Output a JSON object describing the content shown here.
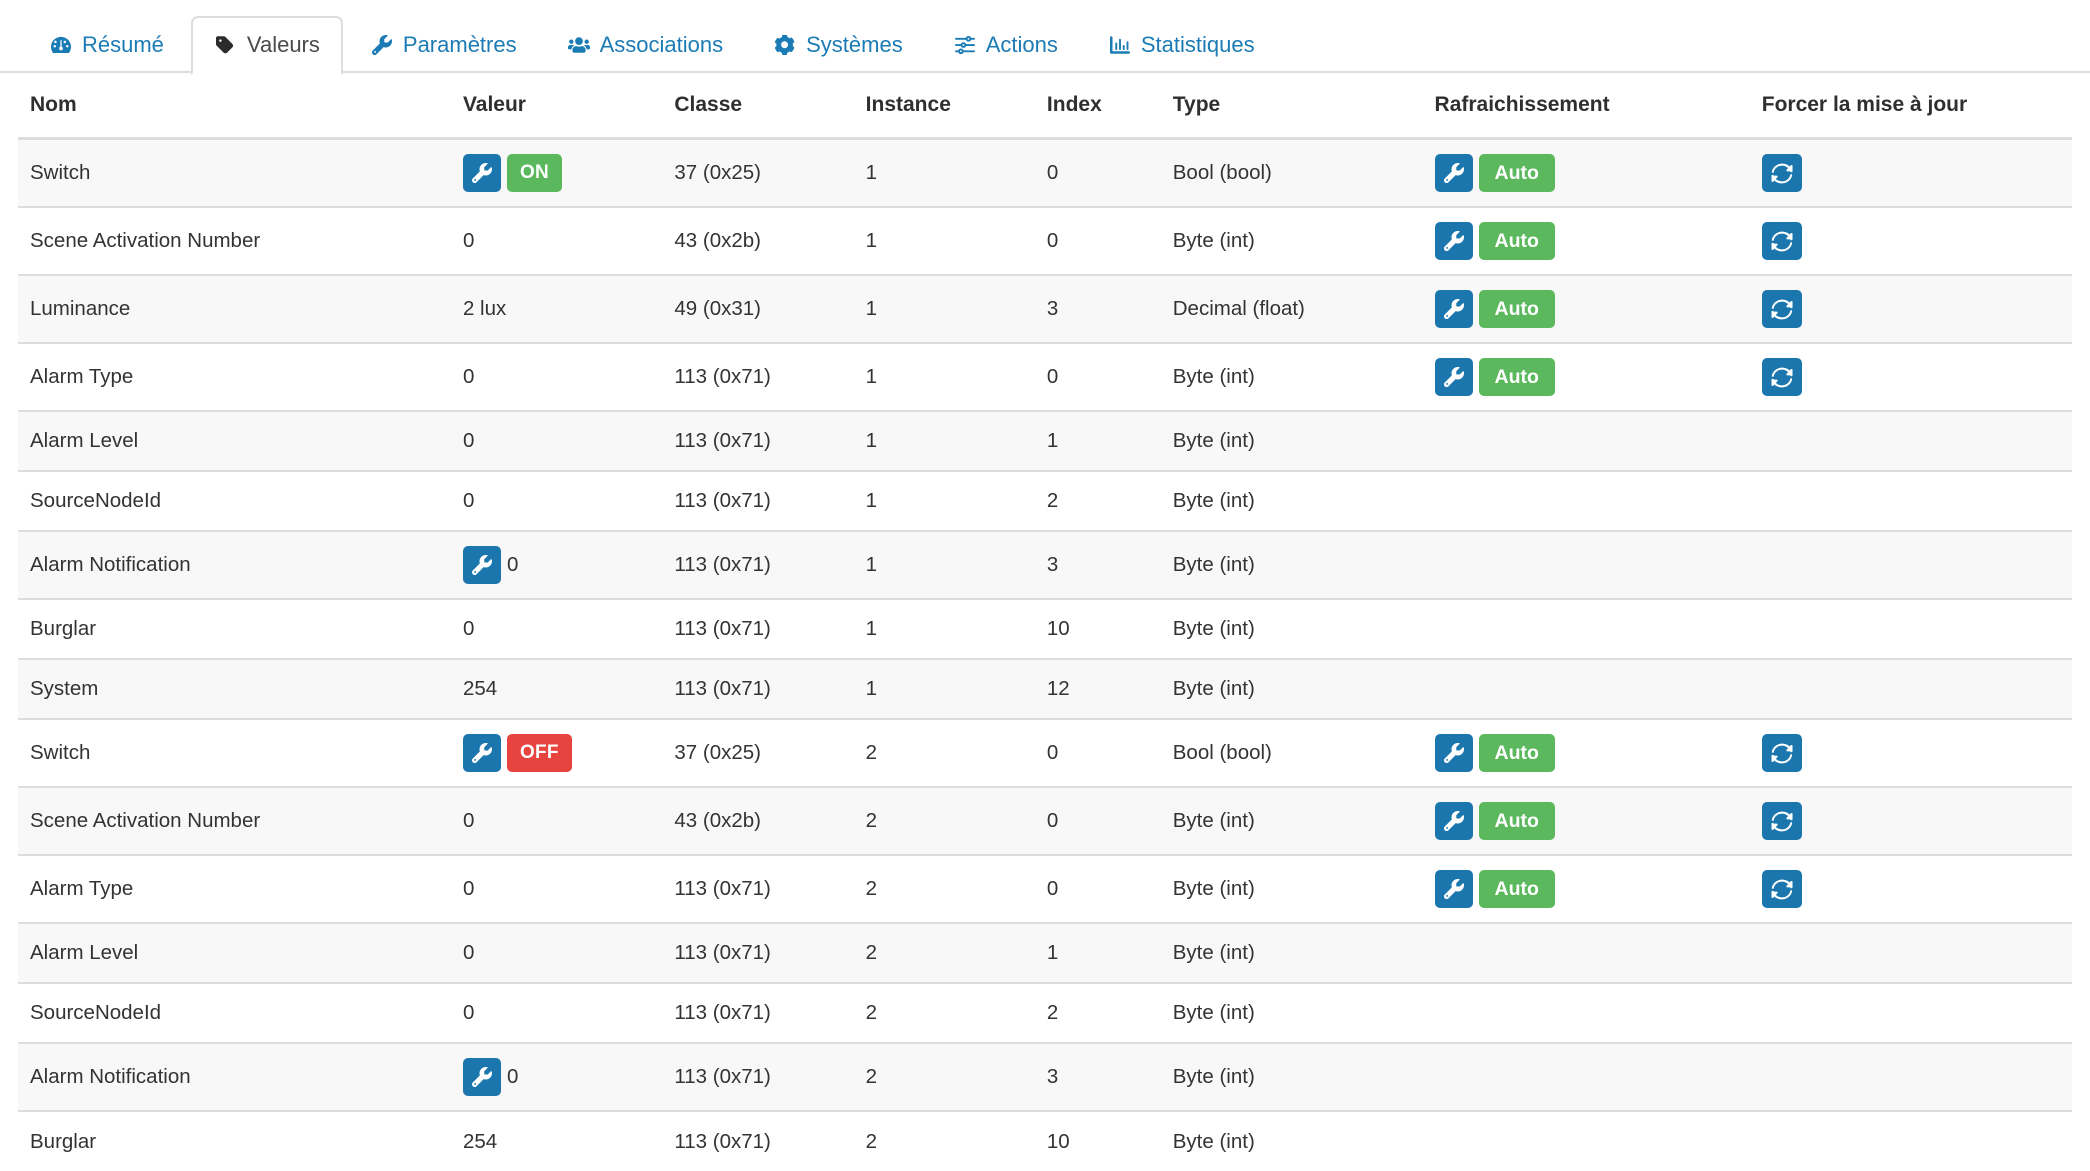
{
  "tabs": [
    {
      "label": "Résumé",
      "icon": "dashboard-icon",
      "active": false
    },
    {
      "label": "Valeurs",
      "icon": "tag-icon",
      "active": true
    },
    {
      "label": "Paramètres",
      "icon": "wrench-icon",
      "active": false
    },
    {
      "label": "Associations",
      "icon": "users-icon",
      "active": false
    },
    {
      "label": "Systèmes",
      "icon": "cogs-icon",
      "active": false
    },
    {
      "label": "Actions",
      "icon": "sliders-icon",
      "active": false
    },
    {
      "label": "Statistiques",
      "icon": "bar-chart-icon",
      "active": false
    }
  ],
  "table": {
    "columns": [
      "Nom",
      "Valeur",
      "Classe",
      "Instance",
      "Index",
      "Type",
      "Rafraichissement",
      "Forcer la mise à jour"
    ],
    "rows": [
      {
        "nom": "Switch",
        "valeur": "ON",
        "valeur_kind": "state-on",
        "classe": "37 (0x25)",
        "instance": "1",
        "index": "0",
        "type": "Bool (bool)",
        "rafraichissement": "Auto",
        "has_refresh_group": true,
        "has_force_button": true
      },
      {
        "nom": "Scene Activation Number",
        "valeur": "0",
        "valeur_kind": "plain",
        "classe": "43 (0x2b)",
        "instance": "1",
        "index": "0",
        "type": "Byte (int)",
        "rafraichissement": "Auto",
        "has_refresh_group": true,
        "has_force_button": true
      },
      {
        "nom": "Luminance",
        "valeur": "2 lux",
        "valeur_kind": "plain",
        "classe": "49 (0x31)",
        "instance": "1",
        "index": "3",
        "type": "Decimal (float)",
        "rafraichissement": "Auto",
        "has_refresh_group": true,
        "has_force_button": true
      },
      {
        "nom": "Alarm Type",
        "valeur": "0",
        "valeur_kind": "plain",
        "classe": "113 (0x71)",
        "instance": "1",
        "index": "0",
        "type": "Byte (int)",
        "rafraichissement": "Auto",
        "has_refresh_group": true,
        "has_force_button": true
      },
      {
        "nom": "Alarm Level",
        "valeur": "0",
        "valeur_kind": "plain",
        "classe": "113 (0x71)",
        "instance": "1",
        "index": "1",
        "type": "Byte (int)",
        "rafraichissement": "",
        "has_refresh_group": false,
        "has_force_button": false
      },
      {
        "nom": "SourceNodeId",
        "valeur": "0",
        "valeur_kind": "plain",
        "classe": "113 (0x71)",
        "instance": "1",
        "index": "2",
        "type": "Byte (int)",
        "rafraichissement": "",
        "has_refresh_group": false,
        "has_force_button": false
      },
      {
        "nom": "Alarm Notification",
        "valeur": "0",
        "valeur_kind": "wrench-plain",
        "classe": "113 (0x71)",
        "instance": "1",
        "index": "3",
        "type": "Byte (int)",
        "rafraichissement": "",
        "has_refresh_group": false,
        "has_force_button": false
      },
      {
        "nom": "Burglar",
        "valeur": "0",
        "valeur_kind": "plain",
        "classe": "113 (0x71)",
        "instance": "1",
        "index": "10",
        "type": "Byte (int)",
        "rafraichissement": "",
        "has_refresh_group": false,
        "has_force_button": false
      },
      {
        "nom": "System",
        "valeur": "254",
        "valeur_kind": "plain",
        "classe": "113 (0x71)",
        "instance": "1",
        "index": "12",
        "type": "Byte (int)",
        "rafraichissement": "",
        "has_refresh_group": false,
        "has_force_button": false
      },
      {
        "nom": "Switch",
        "valeur": "OFF",
        "valeur_kind": "state-off",
        "classe": "37 (0x25)",
        "instance": "2",
        "index": "0",
        "type": "Bool (bool)",
        "rafraichissement": "Auto",
        "has_refresh_group": true,
        "has_force_button": true
      },
      {
        "nom": "Scene Activation Number",
        "valeur": "0",
        "valeur_kind": "plain",
        "classe": "43 (0x2b)",
        "instance": "2",
        "index": "0",
        "type": "Byte (int)",
        "rafraichissement": "Auto",
        "has_refresh_group": true,
        "has_force_button": true
      },
      {
        "nom": "Alarm Type",
        "valeur": "0",
        "valeur_kind": "plain",
        "classe": "113 (0x71)",
        "instance": "2",
        "index": "0",
        "type": "Byte (int)",
        "rafraichissement": "Auto",
        "has_refresh_group": true,
        "has_force_button": true
      },
      {
        "nom": "Alarm Level",
        "valeur": "0",
        "valeur_kind": "plain",
        "classe": "113 (0x71)",
        "instance": "2",
        "index": "1",
        "type": "Byte (int)",
        "rafraichissement": "",
        "has_refresh_group": false,
        "has_force_button": false
      },
      {
        "nom": "SourceNodeId",
        "valeur": "0",
        "valeur_kind": "plain",
        "classe": "113 (0x71)",
        "instance": "2",
        "index": "2",
        "type": "Byte (int)",
        "rafraichissement": "",
        "has_refresh_group": false,
        "has_force_button": false
      },
      {
        "nom": "Alarm Notification",
        "valeur": "0",
        "valeur_kind": "wrench-plain",
        "classe": "113 (0x71)",
        "instance": "2",
        "index": "3",
        "type": "Byte (int)",
        "rafraichissement": "",
        "has_refresh_group": false,
        "has_force_button": false
      },
      {
        "nom": "Burglar",
        "valeur": "254",
        "valeur_kind": "plain",
        "classe": "113 (0x71)",
        "instance": "2",
        "index": "10",
        "type": "Byte (int)",
        "rafraichissement": "",
        "has_refresh_group": false,
        "has_force_button": false
      }
    ]
  },
  "colors": {
    "link_blue": "#1b7bb5",
    "button_blue": "#1b76ad",
    "green": "#5cb85c",
    "red": "#e8443f",
    "border": "#dddddd",
    "stripe": "#f8f8f8"
  },
  "icons": {
    "wrench": "wrench-icon",
    "refresh": "refresh-icon"
  }
}
